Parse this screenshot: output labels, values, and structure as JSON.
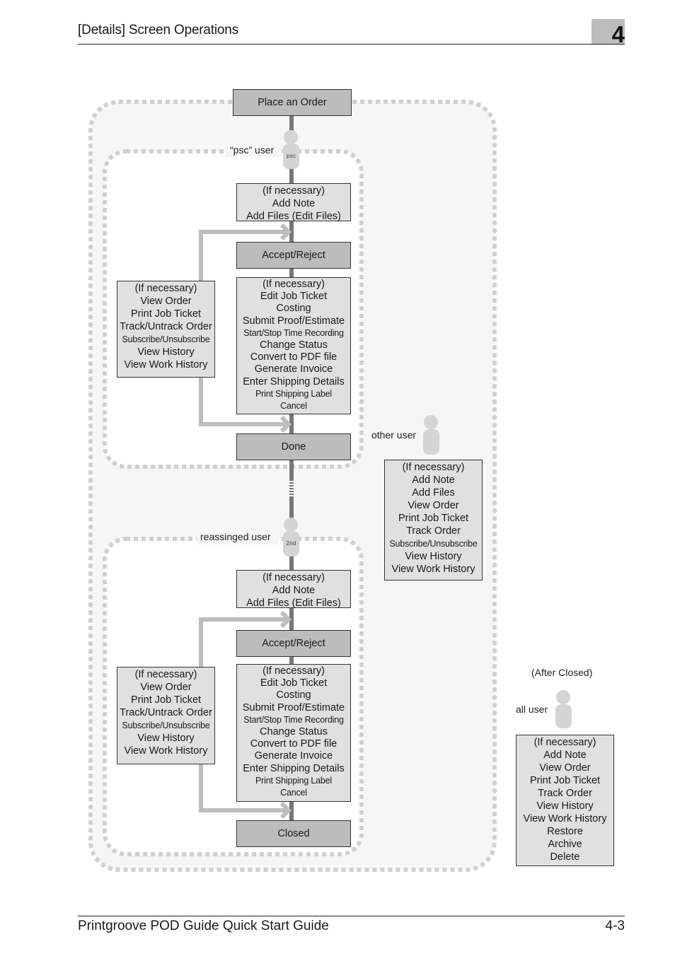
{
  "header": {
    "title": "[Details] Screen Operations",
    "chapter": "4"
  },
  "footer": {
    "title": "Printgroove POD Guide Quick Start Guide",
    "page": "4-3"
  },
  "diagram": {
    "start": "Place an Order",
    "psc_section": {
      "user_label": "“psc” user",
      "badge": "psc",
      "pre_accept": [
        "(If necessary)",
        "Add Note",
        "Add Files (Edit Files)"
      ],
      "accept_reject": "Accept/Reject",
      "side_actions": [
        "(If necessary)",
        "View Order",
        "Print Job Ticket",
        "Track/Untrack Order",
        "Subscribe/Unsubscribe",
        "View History",
        "View Work History"
      ],
      "main_actions": [
        "(If necessary)",
        "Edit Job Ticket",
        "Costing",
        "Submit Proof/Estimate",
        "Start/Stop Time Recording",
        "Change Status",
        "Convert to PDF file",
        "Generate Invoice",
        "Enter Shipping Details",
        "Print Shipping Label",
        "Cancel"
      ],
      "end": "Done"
    },
    "other_user": {
      "label": "other user",
      "actions": [
        "(If necessary)",
        "Add Note",
        "Add Files",
        "View Order",
        "Print Job Ticket",
        "Track Order",
        "Subscribe/Unsubscribe",
        "View History",
        "View Work History"
      ]
    },
    "reassigned_section": {
      "user_label": "reassinged user",
      "badge": "2nd",
      "pre_accept": [
        "(If necessary)",
        "Add Note",
        "Add Files (Edit Files)"
      ],
      "accept_reject": "Accept/Reject",
      "side_actions": [
        "(If necessary)",
        "View Order",
        "Print Job Ticket",
        "Track/Untrack Order",
        "Subscribe/Unsubscribe",
        "View History",
        "View Work History"
      ],
      "main_actions": [
        "(If necessary)",
        "Edit Job Ticket",
        "Costing",
        "Submit Proof/Estimate",
        "Start/Stop Time Recording",
        "Change Status",
        "Convert to PDF file",
        "Generate Invoice",
        "Enter Shipping Details",
        "Print Shipping Label",
        "Cancel"
      ],
      "end": "Closed"
    },
    "after_closed": {
      "caption": "(After Closed)",
      "label": "all user",
      "actions": [
        "(If necessary)",
        "Add Note",
        "View Order",
        "Print Job Ticket",
        "Track Order",
        "View History",
        "View Work History",
        "Restore",
        "Archive",
        "Delete"
      ]
    }
  }
}
